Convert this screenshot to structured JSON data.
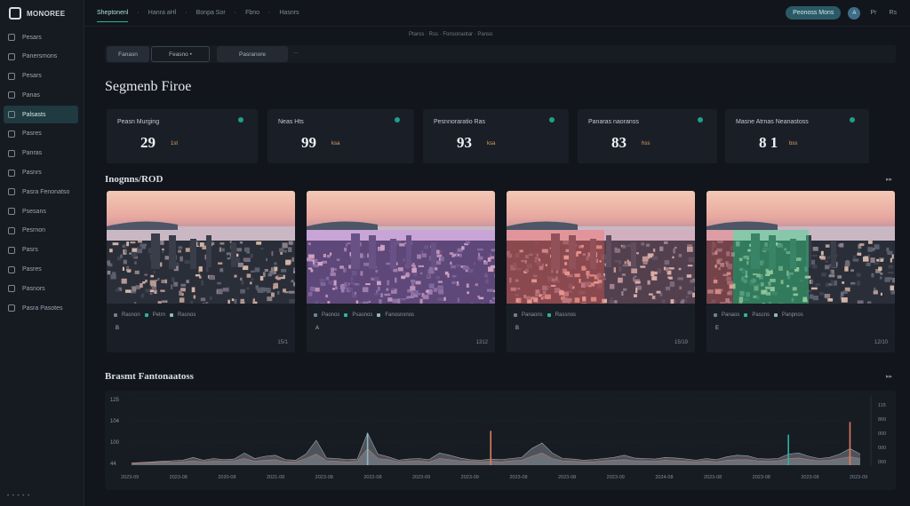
{
  "app": {
    "logo": "MONOREE",
    "logo_sub": "— — — —"
  },
  "sidebar": {
    "items": [
      {
        "label": "Pesars"
      },
      {
        "label": "Panersmons"
      },
      {
        "label": "Pesars"
      },
      {
        "label": "Panas"
      },
      {
        "label": "Palsasts",
        "active": true
      },
      {
        "label": "Pasres"
      },
      {
        "label": "Panras"
      },
      {
        "label": "Pasnrs"
      },
      {
        "label": "Pasra Fenonatso"
      },
      {
        "label": "Psesans"
      },
      {
        "label": "Pesrnon"
      },
      {
        "label": "Pasrs"
      },
      {
        "label": "Pasres"
      },
      {
        "label": "Pasnors"
      },
      {
        "label": "Pasra Pasotes"
      }
    ],
    "footer": "• • •  •  •"
  },
  "topbar": {
    "breadcrumb": [
      "Sheptonenl",
      "·",
      "Hanra aHl",
      "·",
      "Bonpa Sor",
      "·",
      "Fbno",
      "·",
      "Hasnrs"
    ],
    "primary_button": "Peonoss Mons",
    "avatar": "A",
    "icon_buttons": [
      "Pr",
      "Rs"
    ],
    "sub_note": "Ptaros · Rss · Fonsonaotar · Panso"
  },
  "filters": {
    "items": [
      "Fanasn",
      "Feasno  •",
      "Pasranore"
    ],
    "separator": "—"
  },
  "section_title": "Segmenb Firoe",
  "kpis": [
    {
      "label": "Peasn  Murging",
      "value": "29",
      "unit": "1st",
      "accent": "#1f9f8a"
    },
    {
      "label": "Neas  Hts",
      "value": "99",
      "unit": "ksa",
      "accent": "#1f9f8a"
    },
    {
      "label": "Pesnnoraratio  Ras",
      "value": "93",
      "unit": "ksa",
      "accent": "#1f9f8a"
    },
    {
      "label": "Panaras  naoranss",
      "value": "83",
      "unit": "hss",
      "accent": "#1f9f8a"
    },
    {
      "label": "Masne  Atrnas  Neanastoss",
      "value": "8 1",
      "unit": "bss",
      "accent": "#1f9f8a"
    }
  ],
  "images": {
    "title": "Inognns/ROD",
    "more": "▸▸",
    "cards": [
      {
        "captions": [
          "Rasnon",
          "Petrn",
          "Rasnos"
        ],
        "meta": "B",
        "count": "15/1",
        "overlay": "none"
      },
      {
        "captions": [
          "Paonos",
          "Psasnos",
          "Fanosnsnos"
        ],
        "meta": "A",
        "count": "1312",
        "overlay": "purple"
      },
      {
        "captions": [
          "Panaons",
          "Rassnos"
        ],
        "meta": "B",
        "count": "15/19",
        "overlay": "red"
      },
      {
        "captions": [
          "Panaos",
          "Pascns",
          "Panpnos"
        ],
        "meta": "E",
        "count": "12/10",
        "overlay": "green"
      }
    ]
  },
  "chart": {
    "title": "Brasmt Fantonaatoss",
    "more": "▸▸",
    "chart_data": {
      "type": "area",
      "title": "Brasmt Fantonaatoss",
      "ylabels": [
        "125",
        "104",
        "100",
        "44"
      ],
      "right_ticks": [
        "115",
        "800",
        "000",
        "000",
        "000"
      ],
      "xlabels": [
        "2023-09",
        "2023-08",
        "2020-08",
        "2021-08",
        "2023-08",
        "2022-08",
        "2023-09",
        "2023-09",
        "2023-08",
        "2023-08",
        "2023-09",
        "2024-08",
        "2023-08",
        "2023-08",
        "2023-08",
        "2023-09"
      ],
      "ylim": [
        0,
        125
      ],
      "series": [
        {
          "values": [
            4,
            5,
            6,
            7,
            8,
            9,
            14,
            9,
            12,
            10,
            11,
            22,
            12,
            16,
            18,
            10,
            9,
            20,
            45,
            13,
            12,
            10,
            11,
            58,
            20,
            15,
            9,
            11,
            12,
            10,
            22,
            18,
            13,
            10,
            9,
            11,
            10,
            12,
            14,
            30,
            40,
            22,
            12,
            11,
            9,
            10,
            12,
            14,
            18,
            13,
            12,
            11,
            14,
            13,
            11,
            9,
            12,
            10,
            15,
            18,
            17,
            12,
            11,
            12,
            20,
            22,
            16,
            12,
            14,
            20,
            30,
            20
          ]
        },
        {
          "values": [
            3,
            4,
            5,
            6,
            5,
            6,
            8,
            6,
            8,
            7,
            8,
            12,
            7,
            9,
            10,
            6,
            6,
            12,
            20,
            8,
            7,
            6,
            7,
            30,
            12,
            10,
            6,
            7,
            8,
            6,
            12,
            10,
            8,
            7,
            6,
            7,
            6,
            8,
            9,
            16,
            22,
            12,
            8,
            7,
            6,
            6,
            8,
            9,
            10,
            8,
            8,
            7,
            9,
            8,
            7,
            6,
            8,
            6,
            9,
            10,
            10,
            8,
            7,
            8,
            12,
            13,
            10,
            8,
            9,
            12,
            15,
            12
          ]
        }
      ],
      "spikes": [
        {
          "index": 23,
          "value": 58,
          "color": "#8fb8c2"
        },
        {
          "index": 35,
          "value": 62,
          "color": "#e07a5f"
        },
        {
          "index": 64,
          "value": 55,
          "color": "#2bb3a3"
        },
        {
          "index": 70,
          "value": 78,
          "color": "#e07a5f"
        }
      ]
    }
  },
  "colors": {
    "accent": "#2bb3a3",
    "kpi_unit": "#e0a25c",
    "background": "#12161c"
  }
}
